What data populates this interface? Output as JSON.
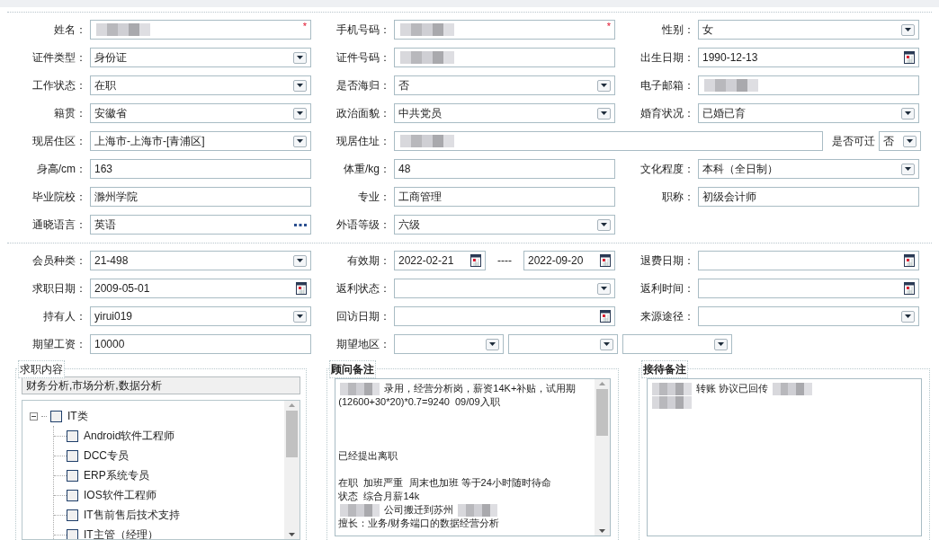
{
  "sections": [
    {
      "rows": [
        [
          {
            "kind": "standard",
            "label": "姓名：",
            "fields": [
              {
                "kind": "text",
                "redacted": true,
                "required_mark": "*"
              }
            ]
          },
          {
            "kind": "standard",
            "label": "手机号码：",
            "fields": [
              {
                "kind": "text",
                "redacted": true,
                "required_mark": "*"
              }
            ]
          },
          {
            "kind": "standard",
            "label": "性别：",
            "fields": [
              {
                "kind": "select",
                "value": "女"
              }
            ]
          }
        ],
        [
          {
            "kind": "standard",
            "label": "证件类型：",
            "fields": [
              {
                "kind": "select",
                "value": "身份证"
              }
            ]
          },
          {
            "kind": "standard",
            "label": "证件号码：",
            "fields": [
              {
                "kind": "text",
                "redacted": true
              }
            ]
          },
          {
            "kind": "standard",
            "label": "出生日期：",
            "fields": [
              {
                "kind": "date",
                "value": "1990-12-13"
              }
            ]
          }
        ],
        [
          {
            "kind": "standard",
            "label": "工作状态：",
            "fields": [
              {
                "kind": "select",
                "value": "在职"
              }
            ]
          },
          {
            "kind": "standard",
            "label": "是否海归：",
            "fields": [
              {
                "kind": "select",
                "value": "否"
              }
            ]
          },
          {
            "kind": "standard",
            "label": "电子邮箱：",
            "fields": [
              {
                "kind": "text",
                "redacted": true
              }
            ]
          }
        ],
        [
          {
            "kind": "standard",
            "label": "籍贯：",
            "fields": [
              {
                "kind": "select",
                "value": "安徽省"
              }
            ]
          },
          {
            "kind": "standard",
            "label": "政治面貌：",
            "fields": [
              {
                "kind": "select",
                "value": "中共党员"
              }
            ]
          },
          {
            "kind": "standard",
            "label": "婚育状况：",
            "fields": [
              {
                "kind": "select",
                "value": "已婚已育"
              }
            ]
          }
        ],
        [
          {
            "kind": "standard",
            "label": "现居住区：",
            "fields": [
              {
                "kind": "select",
                "value": "上海市-上海市-[青浦区]"
              }
            ]
          },
          {
            "kind": "wide",
            "label": "现居住址：",
            "fields": [
              {
                "kind": "text",
                "redacted": true
              }
            ]
          },
          {
            "kind": "inline",
            "label": "是否可迁",
            "fields": [
              {
                "kind": "select",
                "value": "否"
              }
            ]
          }
        ],
        [
          {
            "kind": "standard",
            "label": "身高/cm：",
            "fields": [
              {
                "kind": "text",
                "value": "163"
              }
            ]
          },
          {
            "kind": "standard",
            "label": "体重/kg：",
            "fields": [
              {
                "kind": "text",
                "value": "48"
              }
            ]
          },
          {
            "kind": "standard",
            "label": "文化程度：",
            "fields": [
              {
                "kind": "select",
                "value": "本科（全日制）"
              }
            ]
          }
        ],
        [
          {
            "kind": "standard",
            "label": "毕业院校：",
            "fields": [
              {
                "kind": "text",
                "value": "滁州学院"
              }
            ]
          },
          {
            "kind": "standard",
            "label": "专业：",
            "fields": [
              {
                "kind": "text",
                "value": "工商管理"
              }
            ]
          },
          {
            "kind": "standard",
            "label": "职称：",
            "fields": [
              {
                "kind": "text",
                "value": "初级会计师"
              }
            ]
          }
        ],
        [
          {
            "kind": "standard",
            "label": "通晓语言：",
            "fields": [
              {
                "kind": "lookup",
                "value": "英语"
              }
            ]
          },
          {
            "kind": "standard",
            "label": "外语等级：",
            "fields": [
              {
                "kind": "select",
                "value": "六级"
              }
            ]
          }
        ]
      ]
    },
    {
      "rows": [
        [
          {
            "kind": "standard",
            "label": "会员种类：",
            "fields": [
              {
                "kind": "select",
                "value": " 21-498"
              }
            ]
          },
          {
            "kind": "standard",
            "label": "有效期：",
            "fields": [
              {
                "kind": "date",
                "value": "2022-02-21"
              },
              {
                "kind": "separator",
                "value": "----"
              },
              {
                "kind": "date",
                "value": "2022-09-20"
              }
            ]
          },
          {
            "kind": "standard",
            "label": "退费日期：",
            "fields": [
              {
                "kind": "date"
              }
            ]
          }
        ],
        [
          {
            "kind": "standard",
            "label": "求职日期：",
            "fields": [
              {
                "kind": "date",
                "value": "2009-05-01"
              }
            ]
          },
          {
            "kind": "standard",
            "label": "返利状态：",
            "fields": [
              {
                "kind": "select"
              }
            ]
          },
          {
            "kind": "standard",
            "label": "返利时间：",
            "fields": [
              {
                "kind": "date"
              }
            ]
          }
        ],
        [
          {
            "kind": "standard",
            "label": "持有人：",
            "fields": [
              {
                "kind": "select",
                "value": "yirui019"
              }
            ]
          },
          {
            "kind": "standard",
            "label": "回访日期：",
            "fields": [
              {
                "kind": "date"
              }
            ]
          },
          {
            "kind": "standard",
            "label": "来源途径：",
            "fields": [
              {
                "kind": "select"
              }
            ]
          }
        ],
        [
          {
            "kind": "standard",
            "label": "期望工资：",
            "fields": [
              {
                "kind": "text",
                "value": "10000"
              }
            ]
          },
          {
            "kind": "extended",
            "label": "期望地区：",
            "fields": [
              {
                "kind": "select"
              },
              {
                "kind": "select"
              },
              {
                "kind": "select"
              }
            ]
          }
        ]
      ]
    }
  ],
  "groups": [
    {
      "kind": "tree",
      "title": "求职内容",
      "bold": false,
      "summary": "财务分析,市场分析,数据分析",
      "tree": [
        {
          "label": "IT类",
          "expanded": true,
          "checked": false,
          "children": [
            {
              "label": "Android软件工程师",
              "checked": false
            },
            {
              "label": "DCC专员",
              "checked": false
            },
            {
              "label": "ERP系统专员",
              "checked": false
            },
            {
              "label": "IOS软件工程师",
              "checked": false
            },
            {
              "label": "IT售前售后技术支持",
              "checked": false
            },
            {
              "label": "IT主管（经理）",
              "checked": false
            }
          ]
        }
      ]
    },
    {
      "kind": "notes",
      "title": "顾问备注",
      "bold": true,
      "scrollbar": true,
      "lines": [
        {
          "kind": "content",
          "segments": [
            {
              "kind": "blur"
            },
            {
              "kind": "text",
              "text": "录用，经营分析岗，薪资14K+补贴，试用期"
            }
          ]
        },
        {
          "kind": "content",
          "segments": [
            {
              "kind": "text",
              "text": "(12600+30*20)*0.7=9240  09/09入职"
            }
          ]
        },
        {
          "kind": "blank"
        },
        {
          "kind": "blank"
        },
        {
          "kind": "blank"
        },
        {
          "kind": "content",
          "segments": [
            {
              "kind": "text",
              "text": "已经提出离职"
            }
          ]
        },
        {
          "kind": "blank"
        },
        {
          "kind": "content",
          "segments": [
            {
              "kind": "text",
              "text": "在职  加班严重  周末也加班 等于24小时随时待命"
            }
          ]
        },
        {
          "kind": "content",
          "segments": [
            {
              "kind": "text",
              "text": "状态  综合月薪14k"
            }
          ]
        },
        {
          "kind": "content",
          "segments": [
            {
              "kind": "blur"
            },
            {
              "kind": "text",
              "text": "公司搬迁到苏州"
            },
            {
              "kind": "blur"
            }
          ]
        },
        {
          "kind": "content",
          "segments": [
            {
              "kind": "text",
              "text": "擅长：业务/财务端口的数据经营分析"
            }
          ]
        }
      ]
    },
    {
      "kind": "notes",
      "title": "接待备注",
      "bold": true,
      "scrollbar": false,
      "lines": [
        {
          "kind": "content",
          "segments": [
            {
              "kind": "blur"
            },
            {
              "kind": "text",
              "text": "转账 协议已回传"
            },
            {
              "kind": "blur"
            }
          ]
        },
        {
          "kind": "content",
          "segments": [
            {
              "kind": "blur"
            }
          ]
        }
      ]
    }
  ]
}
